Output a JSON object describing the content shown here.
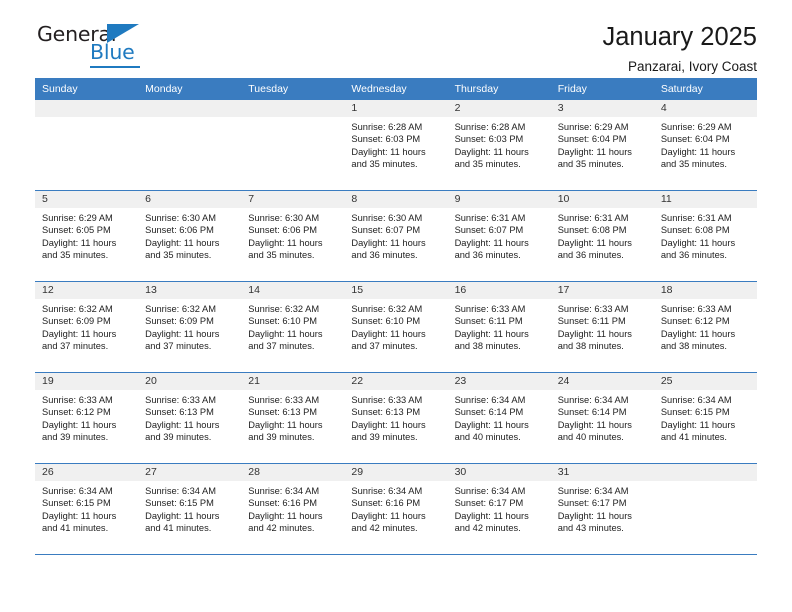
{
  "brand": {
    "name_part1": "General",
    "name_part2": "Blue",
    "accent_color": "#1f7ac0",
    "triangle_icon": "triangle-logo-icon"
  },
  "header": {
    "title": "January 2025",
    "subtitle": "Panzarai, Ivory Coast"
  },
  "theme": {
    "header_blue": "#3a7cc0",
    "date_band_gray": "#f0f0f0",
    "text": "#222222"
  },
  "weekdays": [
    "Sunday",
    "Monday",
    "Tuesday",
    "Wednesday",
    "Thursday",
    "Friday",
    "Saturday"
  ],
  "weeks": [
    [
      {
        "empty": true
      },
      {
        "empty": true
      },
      {
        "empty": true
      },
      {
        "day": "1",
        "sunrise": "Sunrise: 6:28 AM",
        "sunset": "Sunset: 6:03 PM",
        "daylight1": "Daylight: 11 hours",
        "daylight2": "and 35 minutes."
      },
      {
        "day": "2",
        "sunrise": "Sunrise: 6:28 AM",
        "sunset": "Sunset: 6:03 PM",
        "daylight1": "Daylight: 11 hours",
        "daylight2": "and 35 minutes."
      },
      {
        "day": "3",
        "sunrise": "Sunrise: 6:29 AM",
        "sunset": "Sunset: 6:04 PM",
        "daylight1": "Daylight: 11 hours",
        "daylight2": "and 35 minutes."
      },
      {
        "day": "4",
        "sunrise": "Sunrise: 6:29 AM",
        "sunset": "Sunset: 6:04 PM",
        "daylight1": "Daylight: 11 hours",
        "daylight2": "and 35 minutes."
      }
    ],
    [
      {
        "day": "5",
        "sunrise": "Sunrise: 6:29 AM",
        "sunset": "Sunset: 6:05 PM",
        "daylight1": "Daylight: 11 hours",
        "daylight2": "and 35 minutes."
      },
      {
        "day": "6",
        "sunrise": "Sunrise: 6:30 AM",
        "sunset": "Sunset: 6:06 PM",
        "daylight1": "Daylight: 11 hours",
        "daylight2": "and 35 minutes."
      },
      {
        "day": "7",
        "sunrise": "Sunrise: 6:30 AM",
        "sunset": "Sunset: 6:06 PM",
        "daylight1": "Daylight: 11 hours",
        "daylight2": "and 35 minutes."
      },
      {
        "day": "8",
        "sunrise": "Sunrise: 6:30 AM",
        "sunset": "Sunset: 6:07 PM",
        "daylight1": "Daylight: 11 hours",
        "daylight2": "and 36 minutes."
      },
      {
        "day": "9",
        "sunrise": "Sunrise: 6:31 AM",
        "sunset": "Sunset: 6:07 PM",
        "daylight1": "Daylight: 11 hours",
        "daylight2": "and 36 minutes."
      },
      {
        "day": "10",
        "sunrise": "Sunrise: 6:31 AM",
        "sunset": "Sunset: 6:08 PM",
        "daylight1": "Daylight: 11 hours",
        "daylight2": "and 36 minutes."
      },
      {
        "day": "11",
        "sunrise": "Sunrise: 6:31 AM",
        "sunset": "Sunset: 6:08 PM",
        "daylight1": "Daylight: 11 hours",
        "daylight2": "and 36 minutes."
      }
    ],
    [
      {
        "day": "12",
        "sunrise": "Sunrise: 6:32 AM",
        "sunset": "Sunset: 6:09 PM",
        "daylight1": "Daylight: 11 hours",
        "daylight2": "and 37 minutes."
      },
      {
        "day": "13",
        "sunrise": "Sunrise: 6:32 AM",
        "sunset": "Sunset: 6:09 PM",
        "daylight1": "Daylight: 11 hours",
        "daylight2": "and 37 minutes."
      },
      {
        "day": "14",
        "sunrise": "Sunrise: 6:32 AM",
        "sunset": "Sunset: 6:10 PM",
        "daylight1": "Daylight: 11 hours",
        "daylight2": "and 37 minutes."
      },
      {
        "day": "15",
        "sunrise": "Sunrise: 6:32 AM",
        "sunset": "Sunset: 6:10 PM",
        "daylight1": "Daylight: 11 hours",
        "daylight2": "and 37 minutes."
      },
      {
        "day": "16",
        "sunrise": "Sunrise: 6:33 AM",
        "sunset": "Sunset: 6:11 PM",
        "daylight1": "Daylight: 11 hours",
        "daylight2": "and 38 minutes."
      },
      {
        "day": "17",
        "sunrise": "Sunrise: 6:33 AM",
        "sunset": "Sunset: 6:11 PM",
        "daylight1": "Daylight: 11 hours",
        "daylight2": "and 38 minutes."
      },
      {
        "day": "18",
        "sunrise": "Sunrise: 6:33 AM",
        "sunset": "Sunset: 6:12 PM",
        "daylight1": "Daylight: 11 hours",
        "daylight2": "and 38 minutes."
      }
    ],
    [
      {
        "day": "19",
        "sunrise": "Sunrise: 6:33 AM",
        "sunset": "Sunset: 6:12 PM",
        "daylight1": "Daylight: 11 hours",
        "daylight2": "and 39 minutes."
      },
      {
        "day": "20",
        "sunrise": "Sunrise: 6:33 AM",
        "sunset": "Sunset: 6:13 PM",
        "daylight1": "Daylight: 11 hours",
        "daylight2": "and 39 minutes."
      },
      {
        "day": "21",
        "sunrise": "Sunrise: 6:33 AM",
        "sunset": "Sunset: 6:13 PM",
        "daylight1": "Daylight: 11 hours",
        "daylight2": "and 39 minutes."
      },
      {
        "day": "22",
        "sunrise": "Sunrise: 6:33 AM",
        "sunset": "Sunset: 6:13 PM",
        "daylight1": "Daylight: 11 hours",
        "daylight2": "and 39 minutes."
      },
      {
        "day": "23",
        "sunrise": "Sunrise: 6:34 AM",
        "sunset": "Sunset: 6:14 PM",
        "daylight1": "Daylight: 11 hours",
        "daylight2": "and 40 minutes."
      },
      {
        "day": "24",
        "sunrise": "Sunrise: 6:34 AM",
        "sunset": "Sunset: 6:14 PM",
        "daylight1": "Daylight: 11 hours",
        "daylight2": "and 40 minutes."
      },
      {
        "day": "25",
        "sunrise": "Sunrise: 6:34 AM",
        "sunset": "Sunset: 6:15 PM",
        "daylight1": "Daylight: 11 hours",
        "daylight2": "and 41 minutes."
      }
    ],
    [
      {
        "day": "26",
        "sunrise": "Sunrise: 6:34 AM",
        "sunset": "Sunset: 6:15 PM",
        "daylight1": "Daylight: 11 hours",
        "daylight2": "and 41 minutes."
      },
      {
        "day": "27",
        "sunrise": "Sunrise: 6:34 AM",
        "sunset": "Sunset: 6:15 PM",
        "daylight1": "Daylight: 11 hours",
        "daylight2": "and 41 minutes."
      },
      {
        "day": "28",
        "sunrise": "Sunrise: 6:34 AM",
        "sunset": "Sunset: 6:16 PM",
        "daylight1": "Daylight: 11 hours",
        "daylight2": "and 42 minutes."
      },
      {
        "day": "29",
        "sunrise": "Sunrise: 6:34 AM",
        "sunset": "Sunset: 6:16 PM",
        "daylight1": "Daylight: 11 hours",
        "daylight2": "and 42 minutes."
      },
      {
        "day": "30",
        "sunrise": "Sunrise: 6:34 AM",
        "sunset": "Sunset: 6:17 PM",
        "daylight1": "Daylight: 11 hours",
        "daylight2": "and 42 minutes."
      },
      {
        "day": "31",
        "sunrise": "Sunrise: 6:34 AM",
        "sunset": "Sunset: 6:17 PM",
        "daylight1": "Daylight: 11 hours",
        "daylight2": "and 43 minutes."
      },
      {
        "empty": true
      }
    ]
  ]
}
